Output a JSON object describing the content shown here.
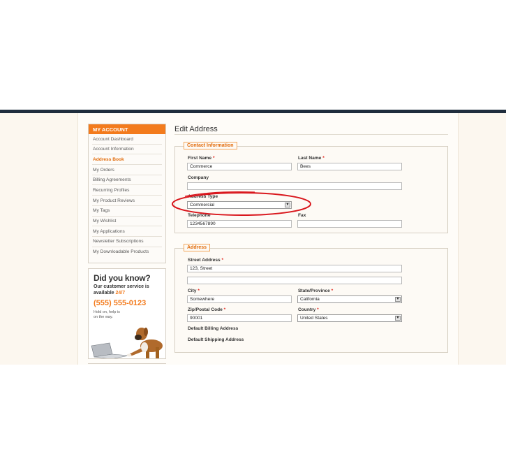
{
  "sidebar": {
    "heading": "MY ACCOUNT",
    "items": [
      {
        "label": "Account Dashboard"
      },
      {
        "label": "Account Information"
      },
      {
        "label": "Address Book"
      },
      {
        "label": "My Orders"
      },
      {
        "label": "Billing Agreements"
      },
      {
        "label": "Recurring Profiles"
      },
      {
        "label": "My Product Reviews"
      },
      {
        "label": "My Tags"
      },
      {
        "label": "My Wishlist"
      },
      {
        "label": "My Applications"
      },
      {
        "label": "Newsletter Subscriptions"
      },
      {
        "label": "My Downloadable Products"
      }
    ],
    "active_item": "Address Book"
  },
  "promo": {
    "title": "Did you know?",
    "line1": "Our customer service is",
    "line2_prefix": "available ",
    "line2_accent": "24/7",
    "phone": "(555) 555-0123",
    "sub1": "Hold on, help is",
    "sub2": "on the way."
  },
  "main": {
    "title": "Edit Address",
    "contact": {
      "legend": "Contact Information",
      "first_name_label": "First Name",
      "first_name_value": "Commerce",
      "last_name_label": "Last Name",
      "last_name_value": "Bees",
      "company_label": "Company",
      "company_value": "",
      "address_type_label": "Address Type",
      "address_type_value": "Commercial",
      "telephone_label": "Telephone",
      "telephone_value": "1234567890",
      "fax_label": "Fax",
      "fax_value": ""
    },
    "address": {
      "legend": "Address",
      "street_label": "Street Address",
      "street_line1": "123, Street",
      "street_line2": "",
      "city_label": "City",
      "city_value": "Somewhere",
      "state_label": "State/Province",
      "state_value": "California",
      "zip_label": "Zip/Postal Code",
      "zip_value": "90001",
      "country_label": "Country",
      "country_value": "United States",
      "default_billing_label": "Default Billing Address",
      "default_shipping_label": "Default Shipping Address"
    },
    "required_marker": "*"
  },
  "colors": {
    "accent": "#f37b1d",
    "header_bar": "#1f2d3d",
    "required": "#e2231a",
    "highlight_oval": "#d9161c"
  },
  "icons": {
    "select_arrow": "chevron-down-icon"
  }
}
